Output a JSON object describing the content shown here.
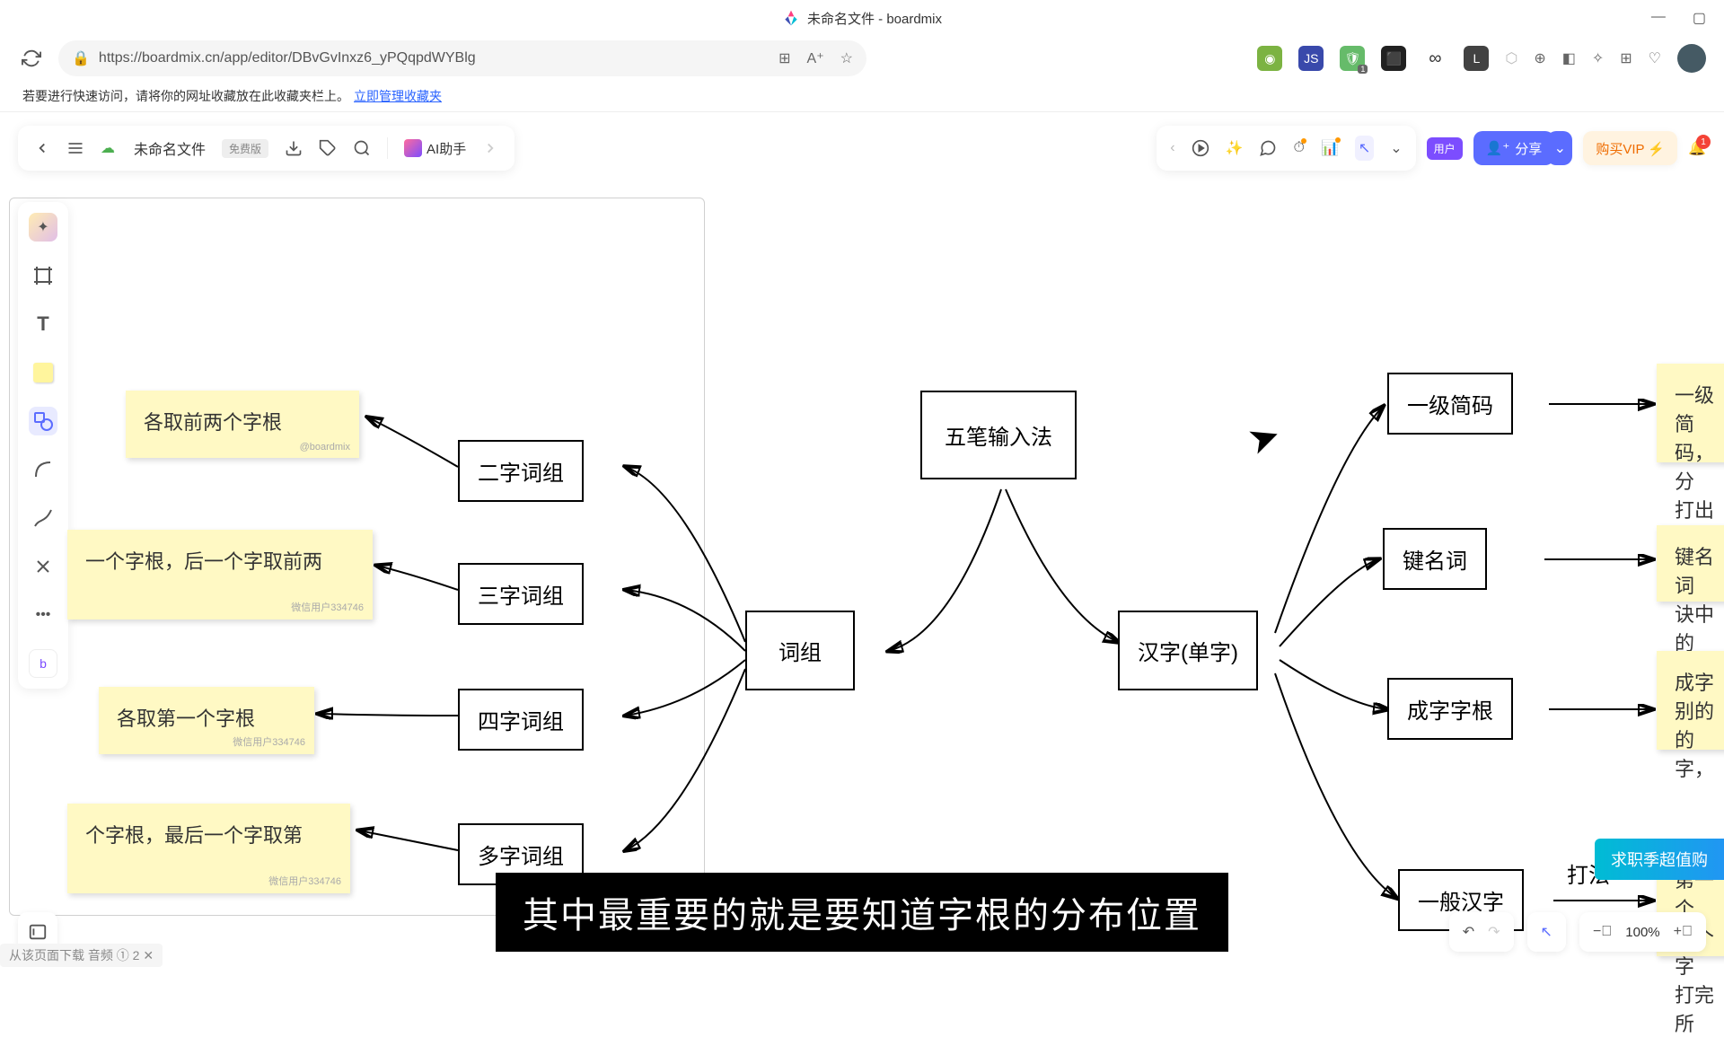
{
  "window": {
    "title": "未命名文件 - boardmix"
  },
  "addressbar": {
    "url": "https://boardmix.cn/app/editor/DBvGvInxz6_yPQqpdWYBlg"
  },
  "bookmarkbar": {
    "hint": "若要进行快速访问，请将你的网址收藏放在此收藏夹栏上。",
    "link": "立即管理收藏夹"
  },
  "toolbar": {
    "doc_title": "未命名文件",
    "free_badge": "免费版",
    "ai_label": "AI助手",
    "user_badge": "用户",
    "share": "分享",
    "vip": "购买VIP ⚡",
    "bell_count": "1"
  },
  "canvas": {
    "nodes": {
      "root": "五笔输入法",
      "cizu": "词组",
      "hanzi": "汉字(单字)",
      "er": "二字词组",
      "san": "三字词组",
      "si": "四字词组",
      "duo": "多字词组",
      "yiji": "一级简码",
      "jianming": "键名词",
      "chengzi": "成字字根",
      "yiban": "一般汉字"
    },
    "notes": {
      "n1": "各取前两个字根",
      "n2": "一个字根，后一个字取前两",
      "n3": "各取第一个字根",
      "n4": "个字根，最后一个字取第",
      "r1": "一级简\n码，分\n打出",
      "r2": "键名词\n诀中的",
      "r3": "成字\n别的\n的字，",
      "r4": "第一个\n一个字\n打完所"
    },
    "edge_label": "打法",
    "watermark": "微信用户334746"
  },
  "subtitle": "其中最重要的就是要知道字根的分布位置",
  "zoom": {
    "level": "100%"
  },
  "promo": "求职季超值购",
  "download": "从该页面下载 音频 ① 2 ✕"
}
